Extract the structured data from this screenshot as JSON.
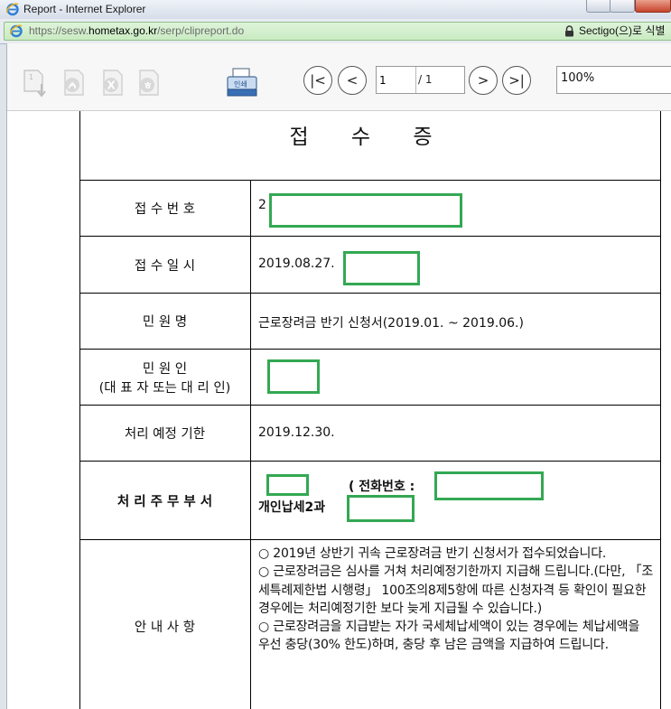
{
  "window": {
    "title": "Report - Internet Explorer"
  },
  "address": {
    "scheme": "https://",
    "host_prefix": "sesw.",
    "host": "hometax.go.kr",
    "path": "/serp/clipreport.do",
    "cert": "Sectigo(으)로 식별"
  },
  "toolbar": {
    "first_label": "|<",
    "prev_label": "<",
    "next_label": ">",
    "last_label": ">|",
    "current_page": "1",
    "total_pages": "/ 1",
    "zoom": "100%",
    "print_label": "인쇄"
  },
  "doc": {
    "title": "접 수 증",
    "rows": [
      {
        "label": "접 수 번 호",
        "value": "2"
      },
      {
        "label": "접 수 일 시",
        "value": "2019.08.27."
      },
      {
        "label": "민 원 명",
        "value": "근로장려금 반기 신청서(2019.01. ~ 2019.06.)"
      },
      {
        "label": "민 원 인",
        "label2": "(대 표 자 또는 대 리 인)",
        "value": ""
      },
      {
        "label": "처리 예정 기한",
        "value": "2019.12.30."
      },
      {
        "label": "처 리 주 무 부 서",
        "value_line1a": ")",
        "value_line1b": "( 전화번호 :",
        "value_line1c": ")",
        "value_line2": "개인납세2과"
      },
      {
        "label": "안 내 사 항",
        "notice": [
          "○ 2019년 상반기 귀속 근로장려금 반기 신청서가 접수되었습니다.",
          "○ 근로장려금은 심사를 거쳐 처리예정기한까지 지급해 드립니다.(다만, 「조세특례제한법 시행령」 100조의8제5항에 따른 신청자격 등 확인이 필요한 경우에는 처리예정기한 보다 늦게 지급될 수 있습니다.)",
          "○ 근로장려금을 지급받는 자가 국세체납세액이 있는 경우에는 체납세액을 우선 충당(30% 한도)하며, 충당 후 남은 금액을 지급하여 드립니다."
        ]
      }
    ]
  },
  "colors": {
    "redaction_border": "#33a853",
    "secure_green": "#c9ebc2"
  }
}
